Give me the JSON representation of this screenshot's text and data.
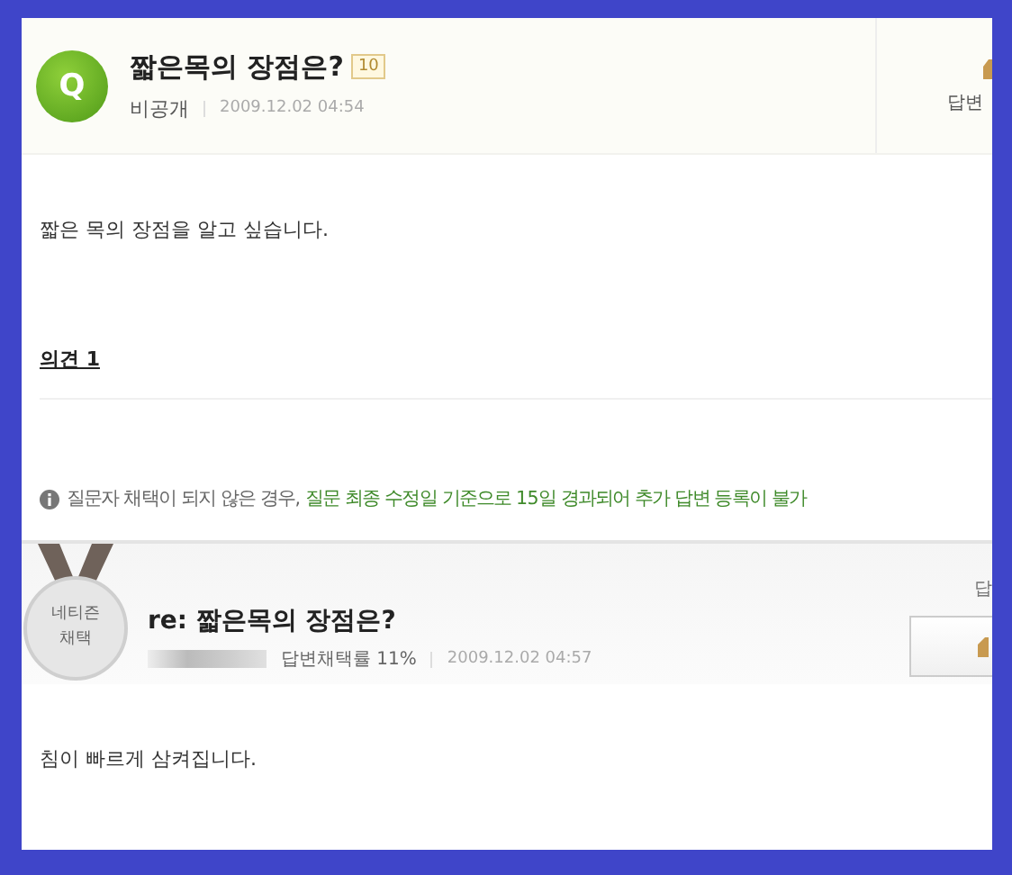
{
  "question": {
    "avatar": "Q",
    "title": "짧은목의 장점은?",
    "points": "10",
    "author": "비공개",
    "date": "2009.12.02 04:54",
    "side_label": "답변",
    "body": "짧은 목의 장점을 알고 싶습니다."
  },
  "opinions": {
    "heading": "의견 1"
  },
  "notice": {
    "lead": "질문자 채택이 되지 않은 경우,",
    "highlight": "질문 최종 수정일 기준으로 15일 경과되어 추가 답변 등록이 불가"
  },
  "answer": {
    "medal": "네티즌 채택",
    "title": "re: 짧은목의 장점은?",
    "rate": "답변채택률 11%",
    "date": "2009.12.02 04:57",
    "side_label": "답",
    "body": "침이 빠르게 삼켜집니다."
  }
}
